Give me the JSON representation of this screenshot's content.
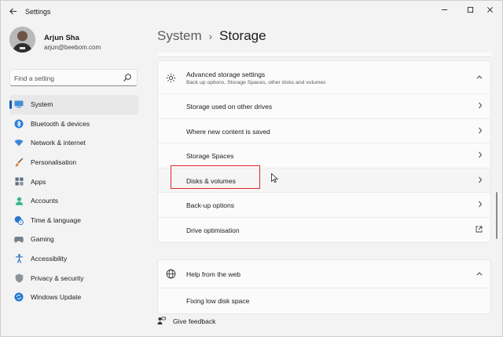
{
  "window": {
    "title": "Settings"
  },
  "profile": {
    "name": "Arjun Sha",
    "email": "arjun@beebom.com"
  },
  "search": {
    "placeholder": "Find a setting"
  },
  "nav": {
    "items": [
      {
        "label": "System",
        "icon": "monitor-icon",
        "active": true
      },
      {
        "label": "Bluetooth & devices",
        "icon": "bluetooth-icon"
      },
      {
        "label": "Network & internet",
        "icon": "wifi-icon"
      },
      {
        "label": "Personalisation",
        "icon": "brush-icon"
      },
      {
        "label": "Apps",
        "icon": "apps-icon"
      },
      {
        "label": "Accounts",
        "icon": "person-icon"
      },
      {
        "label": "Time & language",
        "icon": "clock-globe-icon"
      },
      {
        "label": "Gaming",
        "icon": "gamepad-icon"
      },
      {
        "label": "Accessibility",
        "icon": "accessibility-icon"
      },
      {
        "label": "Privacy & security",
        "icon": "shield-icon"
      },
      {
        "label": "Windows Update",
        "icon": "update-icon"
      }
    ]
  },
  "breadcrumb": {
    "parent": "System",
    "separator": "›",
    "current": "Storage"
  },
  "advanced": {
    "title": "Advanced storage settings",
    "subtitle": "Back up options, Storage Spaces, other disks and volumes",
    "rows": [
      {
        "label": "Storage used on other drives"
      },
      {
        "label": "Where new content is saved"
      },
      {
        "label": "Storage Spaces"
      },
      {
        "label": "Disks & volumes"
      },
      {
        "label": "Back-up options"
      },
      {
        "label": "Drive optimisation"
      }
    ]
  },
  "help": {
    "title": "Help from the web",
    "rows": [
      {
        "label": "Fixing low disk space"
      }
    ]
  },
  "feedback": {
    "label": "Give feedback"
  },
  "colors": {
    "accent": "#0a5fb4",
    "highlight": "#e0252e"
  }
}
